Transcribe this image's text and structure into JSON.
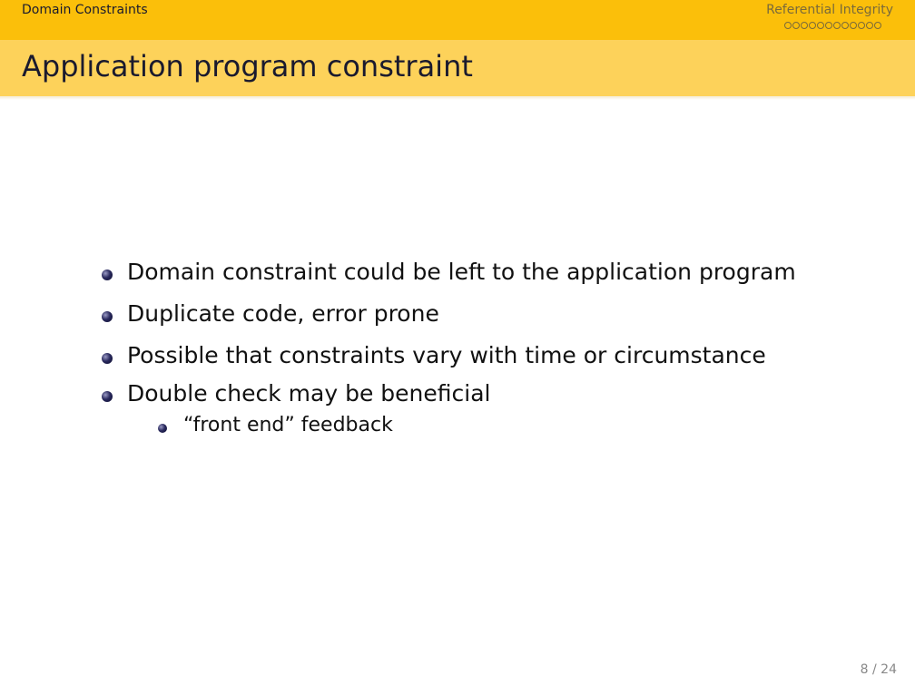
{
  "nav": {
    "left_section": "Domain Constraints",
    "right_section": "Referential Integrity",
    "frame_dots": 12
  },
  "frame": {
    "title": "Application program constraint"
  },
  "bullets": [
    "Domain constraint could be left to the application program",
    "Duplicate code, error prone",
    "Possible that constraints vary with time or circumstance",
    "Double check may be beneficial"
  ],
  "sub_bullets": [
    "“front end” feedback"
  ],
  "footer": {
    "page_number": "8 / 24"
  },
  "colors": {
    "navbar": "#fbbf0a",
    "titlebar": "#fdd25a",
    "title_text": "#1a1a2e",
    "bullet_ball": "#2a2a5e"
  }
}
